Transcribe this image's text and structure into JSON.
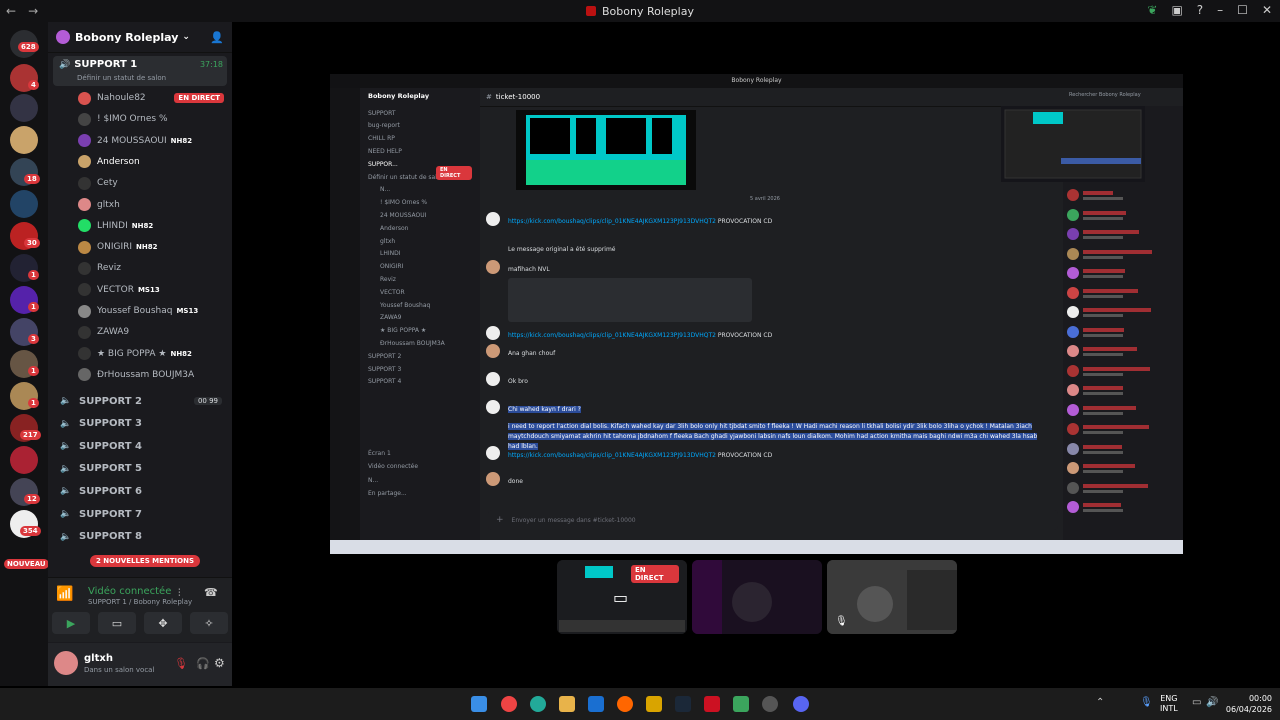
{
  "window": {
    "title": "Bobony Roleplay"
  },
  "rail": {
    "badges": [
      "628",
      "4",
      "18",
      "30",
      "1",
      "1",
      "3",
      "1",
      "1",
      "217",
      "12",
      "354"
    ],
    "new_label": "NOUVEAU"
  },
  "guild": {
    "name": "Bobony Roleplay"
  },
  "active_voice": {
    "name": "SUPPORT 1",
    "timer": "37:18",
    "status": "Définir un statut de salon"
  },
  "members": [
    {
      "name": "Nahoule82",
      "tag": "",
      "live": "EN DIRECT",
      "color": "#d9534f"
    },
    {
      "name": "! $IMO Ornes %",
      "tag": "",
      "live": "",
      "color": "#444"
    },
    {
      "name": "24 MOUSSAOUI",
      "tag": "NH82",
      "live": "",
      "color": "#7a3fb0"
    },
    {
      "name": "Anderson",
      "tag": "",
      "live": "",
      "color": "#c9a36a"
    },
    {
      "name": "Cety",
      "tag": "",
      "live": "",
      "color": "#333"
    },
    {
      "name": "gltxh",
      "tag": "",
      "live": "",
      "color": "#d88"
    },
    {
      "name": "LHINDI",
      "tag": "NH82",
      "live": "",
      "color": "#2d6"
    },
    {
      "name": "ONIGIRI",
      "tag": "NH82",
      "live": "",
      "color": "#b84"
    },
    {
      "name": "Reviz",
      "tag": "",
      "live": "",
      "color": "#333"
    },
    {
      "name": "VECTOR",
      "tag": "MS13",
      "live": "",
      "color": "#333"
    },
    {
      "name": "Youssef Boushaq",
      "tag": "MS13",
      "live": "",
      "color": "#888"
    },
    {
      "name": "ZAWA9",
      "tag": "",
      "live": "",
      "color": "#333"
    },
    {
      "name": "★ BIG POPPA ★",
      "tag": "NH82",
      "live": "",
      "color": "#333"
    },
    {
      "name": "ÐrHoussam BOUJM3A",
      "tag": "",
      "live": "",
      "color": "#666"
    }
  ],
  "voice_channels": [
    {
      "name": "SUPPORT 2",
      "count": "00 99"
    },
    {
      "name": "SUPPORT 3",
      "count": ""
    },
    {
      "name": "SUPPORT 4",
      "count": ""
    },
    {
      "name": "SUPPORT 5",
      "count": ""
    },
    {
      "name": "SUPPORT 6",
      "count": ""
    },
    {
      "name": "SUPPORT 7",
      "count": ""
    },
    {
      "name": "SUPPORT 8",
      "count": ""
    }
  ],
  "mentions_label": "2 NOUVELLES MENTIONS",
  "voice_panel": {
    "title": "Vidéo connectée",
    "subtitle": "SUPPORT 1 / Bobony Roleplay"
  },
  "user": {
    "name": "gltxh",
    "status": "Dans un salon vocal"
  },
  "stream": {
    "title": "Bobony Roleplay",
    "channel": "ticket-10000",
    "search": "Rechercher Bobony Roleplay",
    "date": "5 avril 2026",
    "input_placeholder": "Envoyer un message dans #ticket-10000",
    "channels": [
      "SUPPORT",
      "bug-report",
      "CHILL RP",
      "NEED HELP",
      "SUPPOR...",
      "Définir un statut de salon",
      "N...",
      "! $IMO Ornes %",
      "24 MOUSSAOUI",
      "Anderson",
      "gltxh",
      "LHINDI",
      "ONIGIRI",
      "Reviz",
      "VECTOR",
      "Youssef Boushaq",
      "ZAWA9",
      "★ BIG POPPA ★",
      "ÐrHoussam BOUJM3A",
      "SUPPORT 2",
      "SUPPORT 3",
      "SUPPORT 4",
      "Écran 1",
      "Vidéo connectée",
      "N...",
      "En partage..."
    ],
    "live_label": "EN DIRECT",
    "messages": [
      {
        "text": "https://kick.com/boushaq/clips/clip_01KNE4AJKGXM123PJ913DVHQT2",
        "suffix": "PROVOCATION CD"
      },
      {
        "text": "Le message original a été supprimé",
        "suffix": ""
      },
      {
        "text": "mafihach NVL",
        "suffix": ""
      },
      {
        "text": "https://kick.com/boushaq/clips/clip_01KNE4AJKGXM123PJ913DVHQT2",
        "suffix": "PROVOCATION CD"
      },
      {
        "text": "Ana ghan chouf",
        "suffix": ""
      },
      {
        "text": "Ok bro",
        "suffix": ""
      },
      {
        "text": "Chi wahed kayn f drari ?",
        "suffix": ""
      },
      {
        "text": "i need to report l'action dial bolis.  Kifach wahed kay dar 3lih bolo only hit tjbdat smito f fleeka ! W Hadi machi reason li tkhali bolisi ydir 3lik bolo 3liha o ychok ! Matalan 3iach maytchdouch smiyamat akhrin hit tahoma jbdnahom f fleeka Bach ghadi yjawboni labsin nafs loun dialkom. Mohim had action kmitha mais baghi ndwi m3a chi wahed 3la hsab had lblan.",
        "suffix": ""
      },
      {
        "text": "https://kick.com/boushaq/clips/clip_01KNE4AJKGXM123PJ913DVHQT2",
        "suffix": "PROVOCATION CD"
      },
      {
        "text": "done",
        "suffix": ""
      }
    ]
  },
  "thumb_live": "EN DIRECT",
  "taskbar": {
    "lang": "ENG",
    "layout": "INTL",
    "time": "00:00",
    "date": "06/04/2026"
  }
}
